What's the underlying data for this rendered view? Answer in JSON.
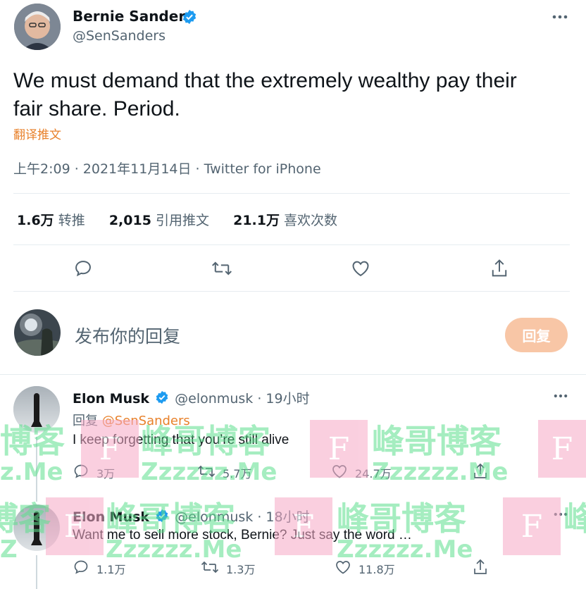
{
  "tweet": {
    "author_name": "Bernie Sanders",
    "author_handle": "@SenSanders",
    "text_line1": "We must demand that the extremely wealthy pay their",
    "text_line2": "fair share. Period.",
    "translate_label": "翻译推文",
    "meta": "上午2:09 · 2021年11月14日 · Twitter for iPhone",
    "stats": {
      "retweets_num": "1.6万",
      "retweets_label": "转推",
      "quotes_num": "2,015",
      "quotes_label": "引用推文",
      "likes_num": "21.1万",
      "likes_label": "喜欢次数"
    }
  },
  "compose": {
    "placeholder": "发布你的回复",
    "reply_button": "回复"
  },
  "replies": [
    {
      "name": "Elon Musk",
      "handle": "@elonmusk",
      "time": "· 19小时",
      "reply_to_prefix": "回复",
      "reply_to": "@SenSanders",
      "text": "I keep forgetting that you’re still alive",
      "replies": "3万",
      "retweets": "5.7万",
      "likes": "24.7万"
    },
    {
      "name": "Elon Musk",
      "handle": "@elonmusk",
      "time": "· 18小时",
      "text": "Want me to sell more stock, Bernie? Just say the word …",
      "replies": "1.1万",
      "retweets": "1.3万",
      "likes": "11.8万"
    }
  ],
  "watermark": {
    "cn": "峰哥博客",
    "en": "Zzzzzz.Me",
    "en_short": "z.Me",
    "cn_short": "博客",
    "cn_edge": "峰",
    "en_short2": "Z",
    "letter": "F"
  },
  "colors": {
    "accent_blue": "#1d9bf0",
    "orange_link": "#e8812b",
    "reply_button_bg": "#f8c6a6"
  }
}
